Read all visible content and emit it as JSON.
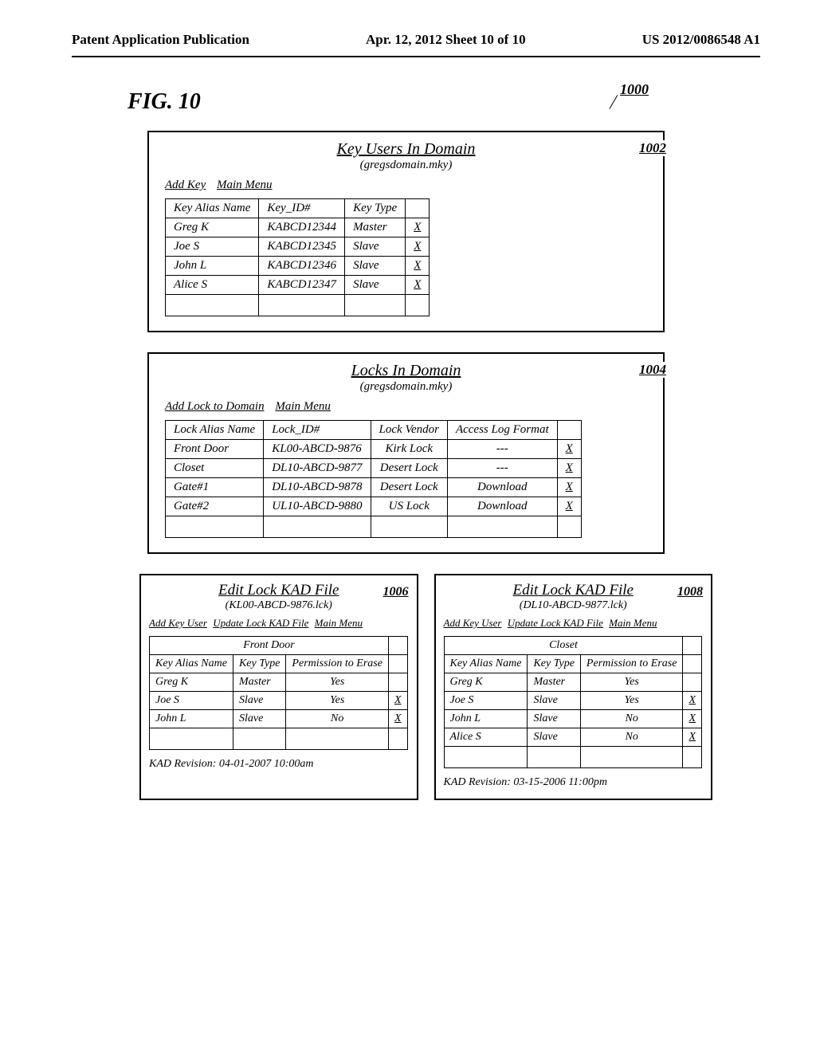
{
  "header": {
    "left": "Patent Application Publication",
    "center": "Apr. 12, 2012  Sheet 10 of 10",
    "right": "US 2012/0086548 A1"
  },
  "figure": {
    "label": "FIG. 10",
    "ref_1000": "1000"
  },
  "panel_keys": {
    "title": "Key Users In Domain",
    "subtitle": "(gregsdomain.mky)",
    "ref": "1002",
    "menu": {
      "add": "Add Key",
      "main": "Main Menu"
    },
    "headers": {
      "alias": "Key Alias Name",
      "id": "Key_ID#",
      "type": "Key Type"
    },
    "rows": [
      {
        "alias": "Greg K",
        "id": "KABCD12344",
        "type": "Master",
        "x": "X"
      },
      {
        "alias": "Joe S",
        "id": "KABCD12345",
        "type": "Slave",
        "x": "X"
      },
      {
        "alias": "John L",
        "id": "KABCD12346",
        "type": "Slave",
        "x": "X"
      },
      {
        "alias": "Alice S",
        "id": "KABCD12347",
        "type": "Slave",
        "x": "X"
      }
    ]
  },
  "panel_locks": {
    "title": "Locks In Domain",
    "subtitle": "(gregsdomain.mky)",
    "ref": "1004",
    "menu": {
      "add": "Add Lock to Domain",
      "main": "Main Menu"
    },
    "headers": {
      "alias": "Lock Alias Name",
      "id": "Lock_ID#",
      "vendor": "Lock Vendor",
      "log": "Access Log Format"
    },
    "rows": [
      {
        "alias": "Front Door",
        "id": "KL00-ABCD-9876",
        "vendor": "Kirk Lock",
        "log": "---",
        "x": "X"
      },
      {
        "alias": "Closet",
        "id": "DL10-ABCD-9877",
        "vendor": "Desert Lock",
        "log": "---",
        "x": "X"
      },
      {
        "alias": "Gate#1",
        "id": "DL10-ABCD-9878",
        "vendor": "Desert Lock",
        "log": "Download",
        "x": "X"
      },
      {
        "alias": "Gate#2",
        "id": "UL10-ABCD-9880",
        "vendor": "US Lock",
        "log": "Download",
        "x": "X"
      }
    ]
  },
  "panel_kad_left": {
    "title": "Edit Lock KAD File",
    "subtitle": "(KL00-ABCD-9876.lck)",
    "ref": "1006",
    "menu": {
      "add": "Add Key User",
      "update": "Update Lock KAD File",
      "main": "Main Menu"
    },
    "lock_name": "Front Door",
    "headers": {
      "alias": "Key Alias Name",
      "type": "Key Type",
      "perm": "Permission to Erase"
    },
    "rows": [
      {
        "alias": "Greg K",
        "type": "Master",
        "perm": "Yes",
        "x": ""
      },
      {
        "alias": "Joe S",
        "type": "Slave",
        "perm": "Yes",
        "x": "X"
      },
      {
        "alias": "John L",
        "type": "Slave",
        "perm": "No",
        "x": "X"
      }
    ],
    "revision": "KAD Revision: 04-01-2007 10:00am"
  },
  "panel_kad_right": {
    "title": "Edit Lock KAD File",
    "subtitle": "(DL10-ABCD-9877.lck)",
    "ref": "1008",
    "menu": {
      "add": "Add Key User",
      "update": "Update Lock KAD File",
      "main": "Main Menu"
    },
    "lock_name": "Closet",
    "headers": {
      "alias": "Key Alias Name",
      "type": "Key Type",
      "perm": "Permission to Erase"
    },
    "rows": [
      {
        "alias": "Greg K",
        "type": "Master",
        "perm": "Yes",
        "x": ""
      },
      {
        "alias": "Joe S",
        "type": "Slave",
        "perm": "Yes",
        "x": "X"
      },
      {
        "alias": "John L",
        "type": "Slave",
        "perm": "No",
        "x": "X"
      },
      {
        "alias": "Alice S",
        "type": "Slave",
        "perm": "No",
        "x": "X"
      }
    ],
    "revision": "KAD Revision: 03-15-2006 11:00pm"
  }
}
